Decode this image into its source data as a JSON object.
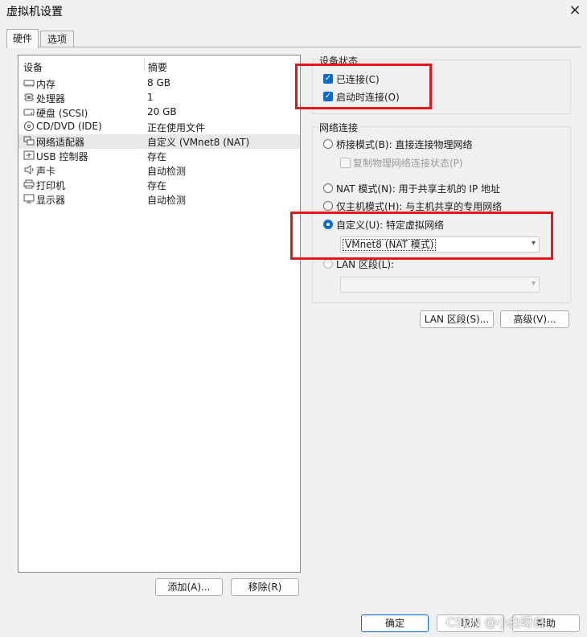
{
  "window": {
    "title": "虚拟机设置",
    "close_icon": "×"
  },
  "tabs": [
    {
      "label": "硬件"
    },
    {
      "label": "选项"
    }
  ],
  "device_list": {
    "col_device": "设备",
    "col_summary": "摘要",
    "rows": [
      {
        "name": "内存",
        "summary": "8 GB",
        "icon": "memory-icon"
      },
      {
        "name": "处理器",
        "summary": "1",
        "icon": "processor-icon"
      },
      {
        "name": "硬盘 (SCSI)",
        "summary": "20 GB",
        "icon": "harddisk-icon"
      },
      {
        "name": "CD/DVD (IDE)",
        "summary": "正在使用文件",
        "icon": "cd-dvd-icon"
      },
      {
        "name": "网络适配器",
        "summary": "自定义 (VMnet8 (NAT)",
        "icon": "network-adapter-icon"
      },
      {
        "name": "USB 控制器",
        "summary": "存在",
        "icon": "usb-icon"
      },
      {
        "name": "声卡",
        "summary": "自动检测",
        "icon": "sound-card-icon"
      },
      {
        "name": "打印机",
        "summary": "存在",
        "icon": "printer-icon"
      },
      {
        "name": "显示器",
        "summary": "自动检测",
        "icon": "display-icon"
      }
    ]
  },
  "device_status": {
    "title": "设备状态",
    "connected": "已连接(C)",
    "connect_at_power_on": "启动时连接(O)"
  },
  "network": {
    "title": "网络连接",
    "bridged": "桥接模式(B): 直接连接物理网络",
    "replicate": "复制物理网络连接状态(P)",
    "nat": "NAT 模式(N): 用于共享主机的 IP 地址",
    "host_only": "仅主机模式(H): 与主机共享的专用网络",
    "custom": "自定义(U): 特定虚拟网络",
    "custom_value": "VMnet8 (NAT 模式)",
    "lan_segment": "LAN 区段(L):",
    "lan_value": ""
  },
  "buttons": {
    "lan_segments": "LAN 区段(S)...",
    "advanced": "高级(V)...",
    "add": "添加(A)...",
    "remove": "移除(R)",
    "ok": "确定",
    "cancel": "取消",
    "help": "帮助"
  },
  "watermark": "CSDN @小白呀白",
  "colors": {
    "accent": "#0b6bcb",
    "highlight_box": "#e8141b"
  }
}
